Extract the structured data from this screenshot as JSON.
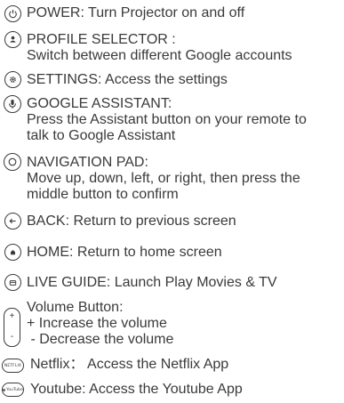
{
  "items": [
    {
      "icon": "power-icon",
      "lines": [
        "POWER: Turn Projector on and off"
      ]
    },
    {
      "icon": "profile-icon",
      "lines": [
        "PROFILE SELECTOR :",
        "Switch between different Google accounts"
      ]
    },
    {
      "icon": "settings-icon",
      "lines": [
        "SETTINGS: Access the settings"
      ]
    },
    {
      "icon": "microphone-icon",
      "lines": [
        "GOOGLE ASSISTANT:",
        "Press the Assistant button on your remote to",
        "talk to Google Assistant"
      ]
    },
    {
      "icon": "navigation-pad-icon",
      "lines": [
        "NAVIGATION PAD:",
        "Move up, down, left, or right, then press the",
        "middle button to confirm"
      ]
    },
    {
      "icon": "back-arrow-icon",
      "lines": [
        "BACK: Return to previous screen"
      ]
    },
    {
      "icon": "home-icon",
      "lines": [
        "HOME: Return to home screen"
      ]
    },
    {
      "icon": "live-guide-icon",
      "lines": [
        "LIVE GUIDE: Launch Play Movies & TV"
      ]
    }
  ],
  "volume": {
    "icon": "volume-rocker-icon",
    "plus_symbol": "+",
    "minus_symbol": "-",
    "lines": [
      "Volume Button:",
      "+ Increase the volume",
      " - Decrease the volume"
    ]
  },
  "netflix": {
    "badge": "NETFLIX",
    "text": "Netflix： Access the Netflix App"
  },
  "youtube": {
    "badge": "YouTube",
    "text": "Youtube: Access the Youtube App"
  },
  "colors": {
    "text": "#3a3a3a",
    "background": "#ffffff"
  }
}
